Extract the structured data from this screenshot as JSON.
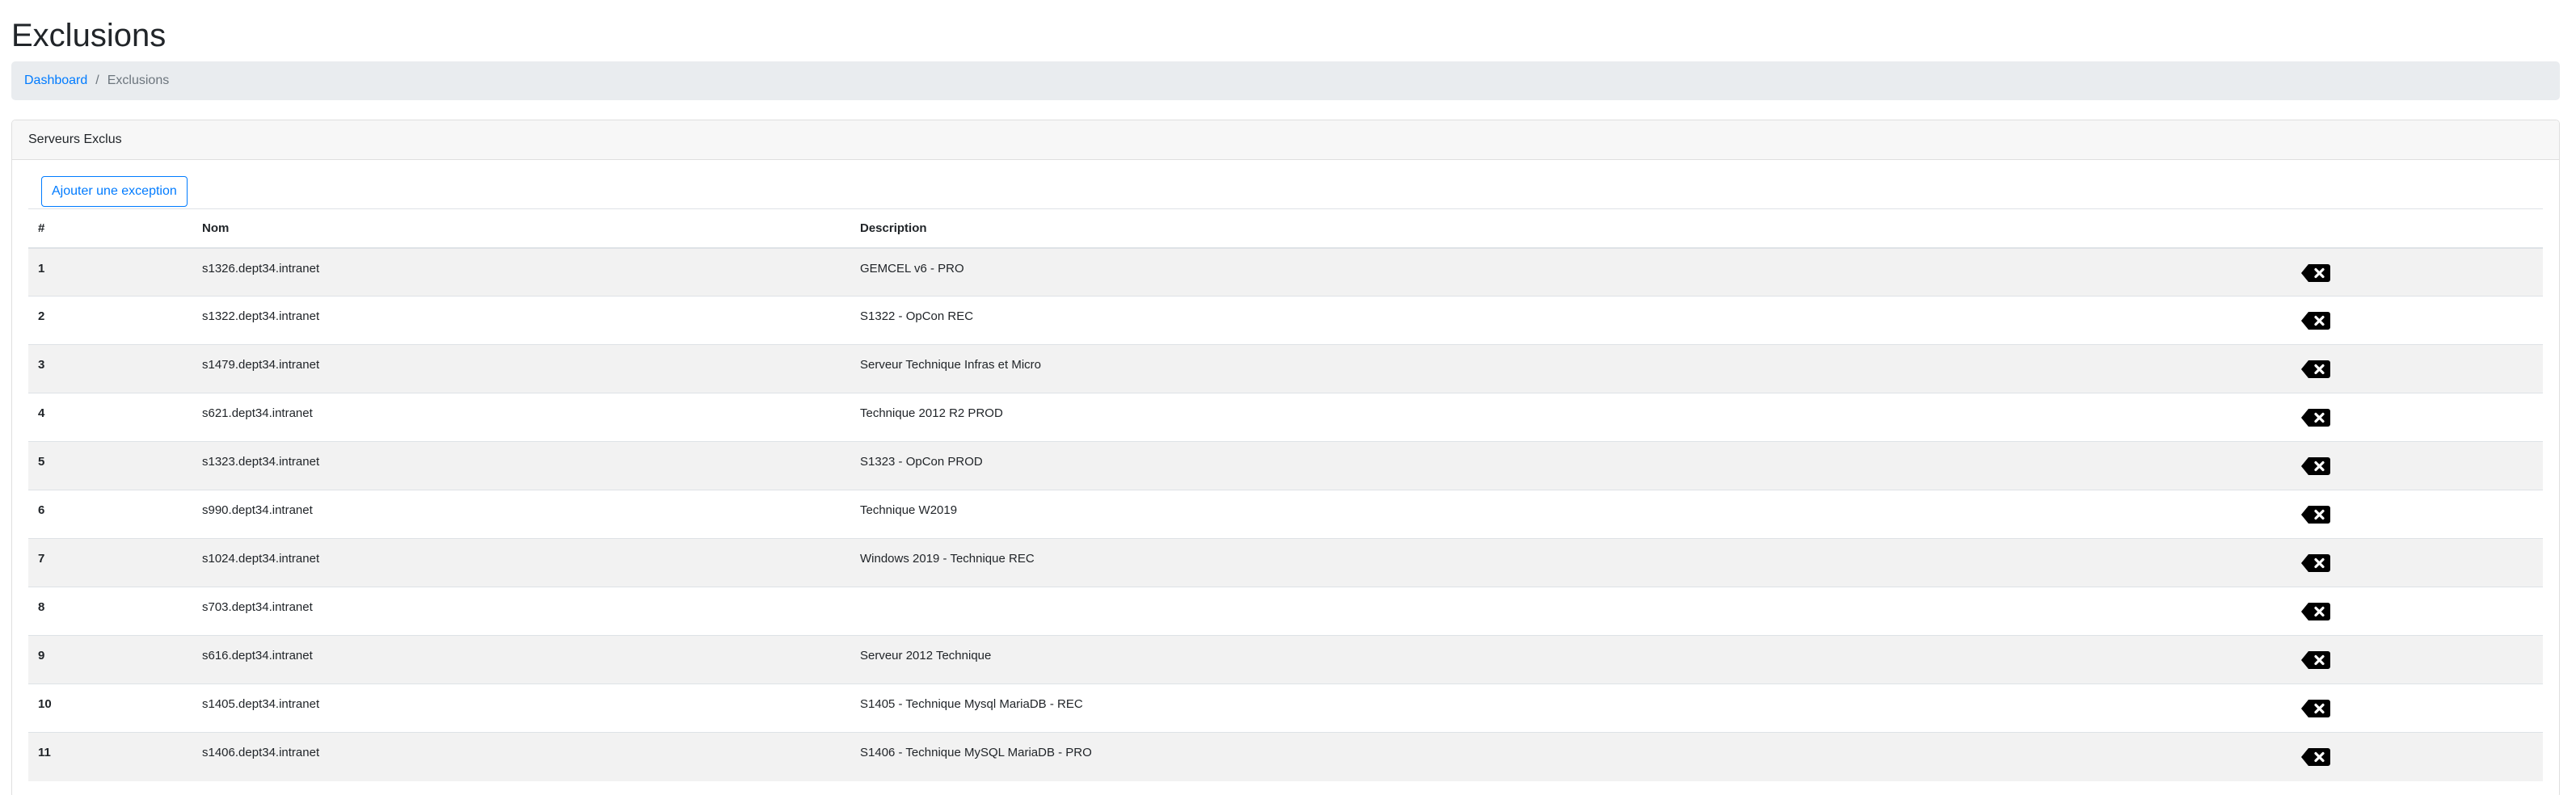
{
  "page": {
    "title": "Exclusions"
  },
  "breadcrumb": {
    "home": "Dashboard",
    "separator": "/",
    "current": "Exclusions"
  },
  "card": {
    "title": "Serveurs Exclus",
    "add_button": "Ajouter une exception"
  },
  "table": {
    "headers": {
      "num": "#",
      "name": "Nom",
      "description": "Description"
    },
    "delete_icon": "backspace-x-icon",
    "rows": [
      {
        "num": "1",
        "name": "s1326.dept34.intranet",
        "description": "GEMCEL v6 - PRO"
      },
      {
        "num": "2",
        "name": "s1322.dept34.intranet",
        "description": "S1322 - OpCon REC"
      },
      {
        "num": "3",
        "name": "s1479.dept34.intranet",
        "description": "Serveur Technique Infras et Micro"
      },
      {
        "num": "4",
        "name": "s621.dept34.intranet",
        "description": "Technique 2012 R2 PROD"
      },
      {
        "num": "5",
        "name": "s1323.dept34.intranet",
        "description": "S1323 - OpCon PROD"
      },
      {
        "num": "6",
        "name": "s990.dept34.intranet",
        "description": "Technique W2019"
      },
      {
        "num": "7",
        "name": "s1024.dept34.intranet",
        "description": "Windows 2019 - Technique REC"
      },
      {
        "num": "8",
        "name": "s703.dept34.intranet",
        "description": ""
      },
      {
        "num": "9",
        "name": "s616.dept34.intranet",
        "description": "Serveur 2012 Technique"
      },
      {
        "num": "10",
        "name": "s1405.dept34.intranet",
        "description": "S1405 - Technique Mysql MariaDB - REC"
      },
      {
        "num": "11",
        "name": "s1406.dept34.intranet",
        "description": "S1406 - Technique MySQL MariaDB - PRO"
      }
    ]
  },
  "colors": {
    "link": "#007bff",
    "breadcrumb_bg": "#e9ecef",
    "stripe": "#f2f2f2"
  }
}
